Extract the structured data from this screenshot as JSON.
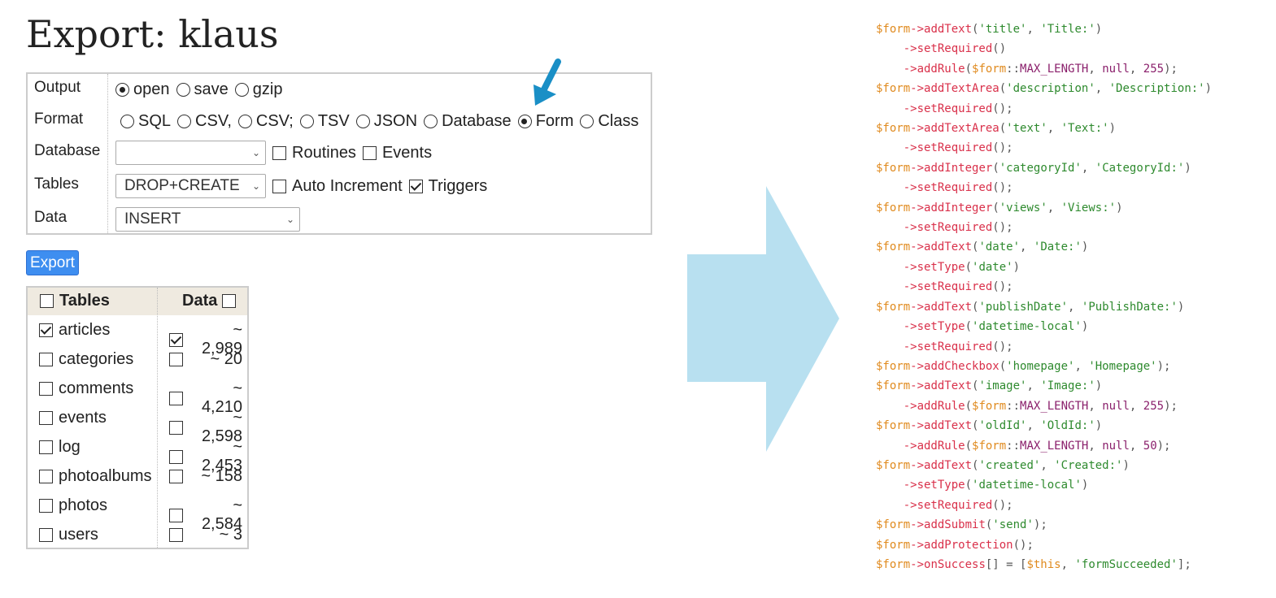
{
  "page": {
    "title": "Export: klaus"
  },
  "options": {
    "output": {
      "label": "Output",
      "choices": [
        {
          "label": "open",
          "selected": true
        },
        {
          "label": "save",
          "selected": false
        },
        {
          "label": "gzip",
          "selected": false
        }
      ]
    },
    "format": {
      "label": "Format",
      "choices": [
        {
          "label": "SQL",
          "selected": false
        },
        {
          "label": "CSV,",
          "selected": false
        },
        {
          "label": "CSV;",
          "selected": false
        },
        {
          "label": "TSV",
          "selected": false
        },
        {
          "label": "JSON",
          "selected": false
        },
        {
          "label": "Database",
          "selected": false
        },
        {
          "label": "Form",
          "selected": true
        },
        {
          "label": "Class",
          "selected": false
        }
      ]
    },
    "database": {
      "label": "Database",
      "select_value": "",
      "routines_label": "Routines",
      "routines_checked": false,
      "events_label": "Events",
      "events_checked": false
    },
    "tables": {
      "label": "Tables",
      "select_value": "DROP+CREATE",
      "auto_increment_label": "Auto Increment",
      "auto_increment_checked": false,
      "triggers_label": "Triggers",
      "triggers_checked": true
    },
    "data": {
      "label": "Data",
      "select_value": "INSERT"
    }
  },
  "export_button": "Export",
  "table_list": {
    "header_tables": "Tables",
    "header_data": "Data",
    "rows": [
      {
        "name": "articles",
        "table_checked": true,
        "data_checked": true,
        "rows": "~ 2,989"
      },
      {
        "name": "categories",
        "table_checked": false,
        "data_checked": false,
        "rows": "~ 20"
      },
      {
        "name": "comments",
        "table_checked": false,
        "data_checked": false,
        "rows": "~ 4,210"
      },
      {
        "name": "events",
        "table_checked": false,
        "data_checked": false,
        "rows": "~ 2,598"
      },
      {
        "name": "log",
        "table_checked": false,
        "data_checked": false,
        "rows": "~ 2,453"
      },
      {
        "name": "photoalbums",
        "table_checked": false,
        "data_checked": false,
        "rows": "~ 158"
      },
      {
        "name": "photos",
        "table_checked": false,
        "data_checked": false,
        "rows": "~ 2,584"
      },
      {
        "name": "users",
        "table_checked": false,
        "data_checked": false,
        "rows": "~ 3"
      }
    ]
  },
  "icons": {
    "pointer": "blue-pointer-arrow-icon",
    "transform": "big-right-arrow-icon"
  },
  "colors": {
    "export_button": "#3e8ef0",
    "table_header_bg": "#efeae0",
    "pointer_arrow": "#1a8fc6",
    "big_arrow": "#b8e0f0",
    "code_variable": "#e08a1e",
    "code_method": "#d9304a",
    "code_string": "#2e8a2e",
    "code_constant": "#8a1f6b"
  },
  "code_lines": [
    [
      [
        "var",
        "$form"
      ],
      [
        "fn",
        "->addText"
      ],
      [
        "plain",
        "("
      ],
      [
        "str",
        "'title'"
      ],
      [
        "plain",
        ", "
      ],
      [
        "str",
        "'Title:'"
      ],
      [
        "plain",
        ")"
      ]
    ],
    [
      [
        "plain",
        "    "
      ],
      [
        "fn",
        "->setRequired"
      ],
      [
        "plain",
        "()"
      ]
    ],
    [
      [
        "plain",
        "    "
      ],
      [
        "fn",
        "->addRule"
      ],
      [
        "plain",
        "("
      ],
      [
        "var",
        "$form"
      ],
      [
        "plain",
        "::"
      ],
      [
        "const",
        "MAX_LENGTH"
      ],
      [
        "plain",
        ", "
      ],
      [
        "const",
        "null"
      ],
      [
        "plain",
        ", "
      ],
      [
        "const",
        "255"
      ],
      [
        "plain",
        ");"
      ]
    ],
    [
      [
        "var",
        "$form"
      ],
      [
        "fn",
        "->addTextArea"
      ],
      [
        "plain",
        "("
      ],
      [
        "str",
        "'description'"
      ],
      [
        "plain",
        ", "
      ],
      [
        "str",
        "'Description:'"
      ],
      [
        "plain",
        ")"
      ]
    ],
    [
      [
        "plain",
        "    "
      ],
      [
        "fn",
        "->setRequired"
      ],
      [
        "plain",
        "();"
      ]
    ],
    [
      [
        "var",
        "$form"
      ],
      [
        "fn",
        "->addTextArea"
      ],
      [
        "plain",
        "("
      ],
      [
        "str",
        "'text'"
      ],
      [
        "plain",
        ", "
      ],
      [
        "str",
        "'Text:'"
      ],
      [
        "plain",
        ")"
      ]
    ],
    [
      [
        "plain",
        "    "
      ],
      [
        "fn",
        "->setRequired"
      ],
      [
        "plain",
        "();"
      ]
    ],
    [
      [
        "var",
        "$form"
      ],
      [
        "fn",
        "->addInteger"
      ],
      [
        "plain",
        "("
      ],
      [
        "str",
        "'categoryId'"
      ],
      [
        "plain",
        ", "
      ],
      [
        "str",
        "'CategoryId:'"
      ],
      [
        "plain",
        ")"
      ]
    ],
    [
      [
        "plain",
        "    "
      ],
      [
        "fn",
        "->setRequired"
      ],
      [
        "plain",
        "();"
      ]
    ],
    [
      [
        "var",
        "$form"
      ],
      [
        "fn",
        "->addInteger"
      ],
      [
        "plain",
        "("
      ],
      [
        "str",
        "'views'"
      ],
      [
        "plain",
        ", "
      ],
      [
        "str",
        "'Views:'"
      ],
      [
        "plain",
        ")"
      ]
    ],
    [
      [
        "plain",
        "    "
      ],
      [
        "fn",
        "->setRequired"
      ],
      [
        "plain",
        "();"
      ]
    ],
    [
      [
        "var",
        "$form"
      ],
      [
        "fn",
        "->addText"
      ],
      [
        "plain",
        "("
      ],
      [
        "str",
        "'date'"
      ],
      [
        "plain",
        ", "
      ],
      [
        "str",
        "'Date:'"
      ],
      [
        "plain",
        ")"
      ]
    ],
    [
      [
        "plain",
        "    "
      ],
      [
        "fn",
        "->setType"
      ],
      [
        "plain",
        "("
      ],
      [
        "str",
        "'date'"
      ],
      [
        "plain",
        ")"
      ]
    ],
    [
      [
        "plain",
        "    "
      ],
      [
        "fn",
        "->setRequired"
      ],
      [
        "plain",
        "();"
      ]
    ],
    [
      [
        "var",
        "$form"
      ],
      [
        "fn",
        "->addText"
      ],
      [
        "plain",
        "("
      ],
      [
        "str",
        "'publishDate'"
      ],
      [
        "plain",
        ", "
      ],
      [
        "str",
        "'PublishDate:'"
      ],
      [
        "plain",
        ")"
      ]
    ],
    [
      [
        "plain",
        "    "
      ],
      [
        "fn",
        "->setType"
      ],
      [
        "plain",
        "("
      ],
      [
        "str",
        "'datetime-local'"
      ],
      [
        "plain",
        ")"
      ]
    ],
    [
      [
        "plain",
        "    "
      ],
      [
        "fn",
        "->setRequired"
      ],
      [
        "plain",
        "();"
      ]
    ],
    [
      [
        "var",
        "$form"
      ],
      [
        "fn",
        "->addCheckbox"
      ],
      [
        "plain",
        "("
      ],
      [
        "str",
        "'homepage'"
      ],
      [
        "plain",
        ", "
      ],
      [
        "str",
        "'Homepage'"
      ],
      [
        "plain",
        ");"
      ]
    ],
    [
      [
        "var",
        "$form"
      ],
      [
        "fn",
        "->addText"
      ],
      [
        "plain",
        "("
      ],
      [
        "str",
        "'image'"
      ],
      [
        "plain",
        ", "
      ],
      [
        "str",
        "'Image:'"
      ],
      [
        "plain",
        ")"
      ]
    ],
    [
      [
        "plain",
        "    "
      ],
      [
        "fn",
        "->addRule"
      ],
      [
        "plain",
        "("
      ],
      [
        "var",
        "$form"
      ],
      [
        "plain",
        "::"
      ],
      [
        "const",
        "MAX_LENGTH"
      ],
      [
        "plain",
        ", "
      ],
      [
        "const",
        "null"
      ],
      [
        "plain",
        ", "
      ],
      [
        "const",
        "255"
      ],
      [
        "plain",
        ");"
      ]
    ],
    [
      [
        "var",
        "$form"
      ],
      [
        "fn",
        "->addText"
      ],
      [
        "plain",
        "("
      ],
      [
        "str",
        "'oldId'"
      ],
      [
        "plain",
        ", "
      ],
      [
        "str",
        "'OldId:'"
      ],
      [
        "plain",
        ")"
      ]
    ],
    [
      [
        "plain",
        "    "
      ],
      [
        "fn",
        "->addRule"
      ],
      [
        "plain",
        "("
      ],
      [
        "var",
        "$form"
      ],
      [
        "plain",
        "::"
      ],
      [
        "const",
        "MAX_LENGTH"
      ],
      [
        "plain",
        ", "
      ],
      [
        "const",
        "null"
      ],
      [
        "plain",
        ", "
      ],
      [
        "const",
        "50"
      ],
      [
        "plain",
        ");"
      ]
    ],
    [
      [
        "var",
        "$form"
      ],
      [
        "fn",
        "->addText"
      ],
      [
        "plain",
        "("
      ],
      [
        "str",
        "'created'"
      ],
      [
        "plain",
        ", "
      ],
      [
        "str",
        "'Created:'"
      ],
      [
        "plain",
        ")"
      ]
    ],
    [
      [
        "plain",
        "    "
      ],
      [
        "fn",
        "->setType"
      ],
      [
        "plain",
        "("
      ],
      [
        "str",
        "'datetime-local'"
      ],
      [
        "plain",
        ")"
      ]
    ],
    [
      [
        "plain",
        "    "
      ],
      [
        "fn",
        "->setRequired"
      ],
      [
        "plain",
        "();"
      ]
    ],
    [
      [
        "var",
        "$form"
      ],
      [
        "fn",
        "->addSubmit"
      ],
      [
        "plain",
        "("
      ],
      [
        "str",
        "'send'"
      ],
      [
        "plain",
        ");"
      ]
    ],
    [
      [
        "var",
        "$form"
      ],
      [
        "fn",
        "->addProtection"
      ],
      [
        "plain",
        "();"
      ]
    ],
    [
      [
        "var",
        "$form"
      ],
      [
        "fn",
        "->onSuccess"
      ],
      [
        "plain",
        "[] = ["
      ],
      [
        "var",
        "$this"
      ],
      [
        "plain",
        ", "
      ],
      [
        "str",
        "'formSucceeded'"
      ],
      [
        "plain",
        "];"
      ]
    ]
  ]
}
